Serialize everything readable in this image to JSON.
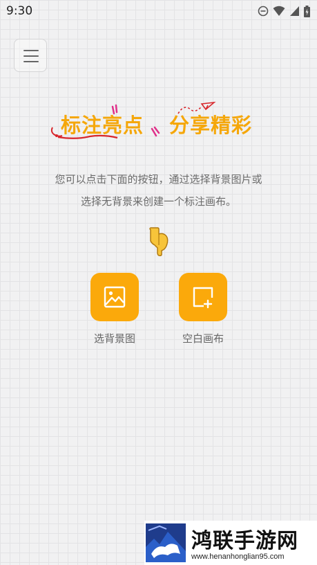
{
  "status_bar": {
    "time": "9:30",
    "icons": [
      "do-not-disturb-icon",
      "wifi-icon",
      "cellular-signal-icon",
      "battery-charging-icon"
    ]
  },
  "menu_button": {
    "icon": "hamburger-menu-icon"
  },
  "banner": {
    "part1": "标注亮点",
    "part2": "分享精彩",
    "color": "#f5a70a"
  },
  "description": {
    "line1": "您可以点击下面的按钮，通过选择背景图片或",
    "line2": "选择无背景来创建一个标注画布。"
  },
  "pointer": {
    "icon": "pointing-down-hand-icon"
  },
  "actions": [
    {
      "label": "选背景图",
      "icon": "image-icon"
    },
    {
      "label": "空白画布",
      "icon": "blank-canvas-add-icon"
    }
  ],
  "accent_color": "#fba90b",
  "watermark": {
    "title": "鸿联手游网",
    "url": "www.henanhonglian95.com"
  }
}
